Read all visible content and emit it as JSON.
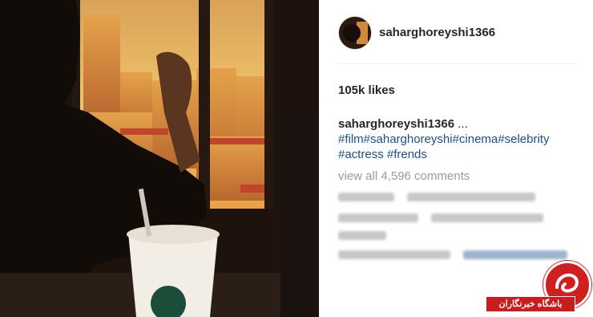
{
  "post": {
    "username": "saharghoreyshi1366",
    "likes": "105k likes",
    "caption_user": "saharghoreyshi1366",
    "caption_ellipsis": " ...",
    "caption_tags_line1": "#film#saharghoreyshi#cinema#selebrity",
    "caption_tags_line2": "#actress #frends",
    "view_all": "view all 4,596 comments"
  },
  "watermark": {
    "text": "باشگاه خبرنگاران"
  },
  "colors": {
    "link": "#1a4f8a",
    "muted": "#9a9a9a",
    "brand_red": "#d01f1f"
  }
}
